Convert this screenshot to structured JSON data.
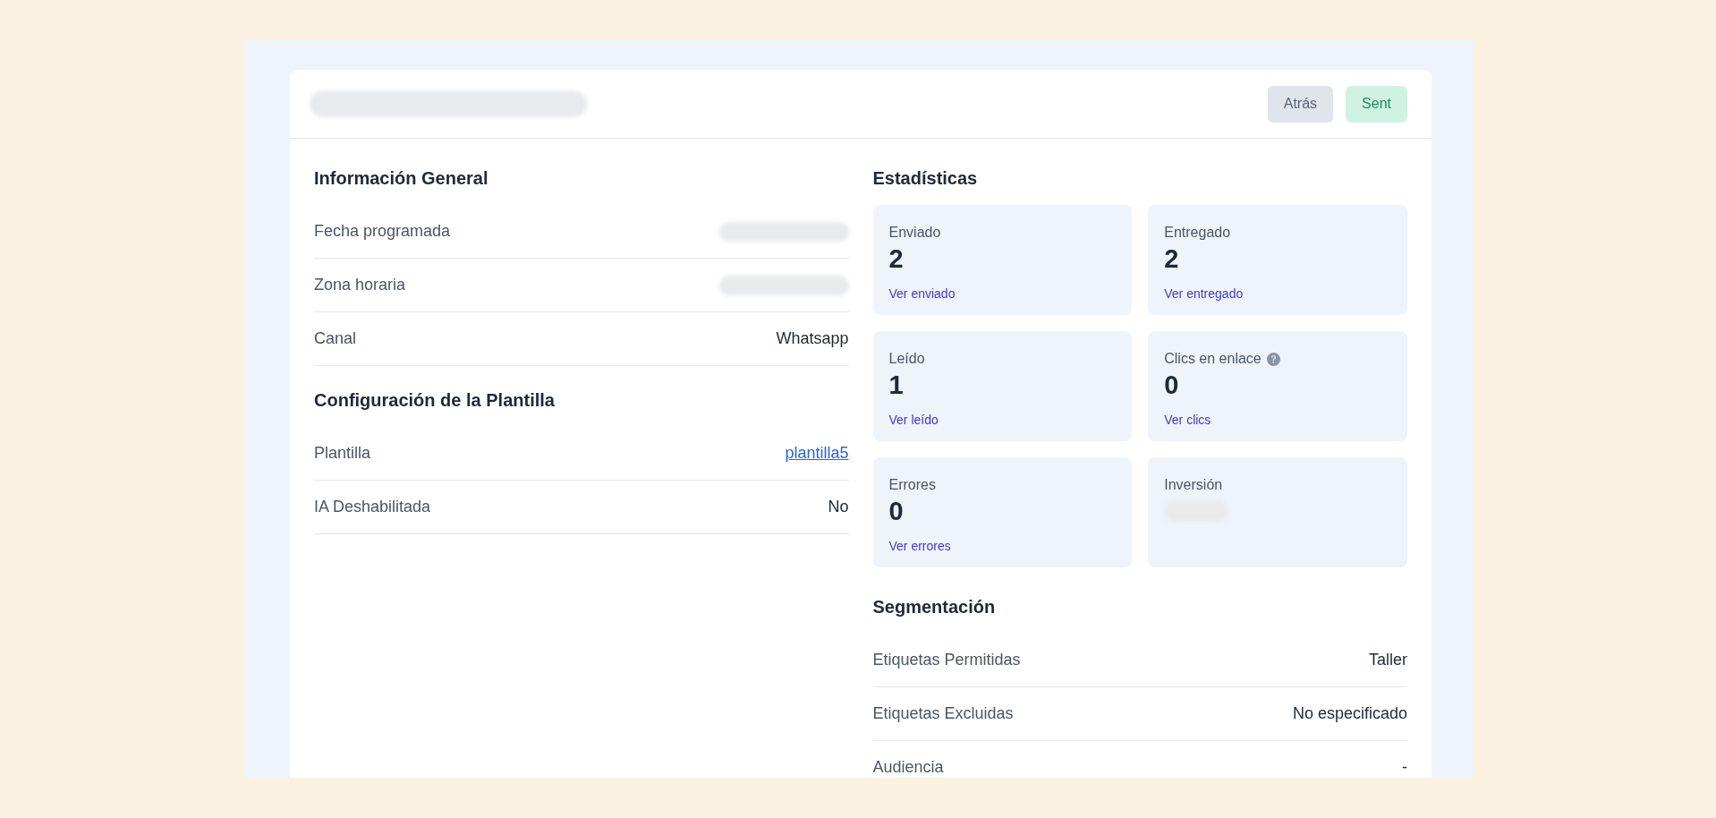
{
  "header": {
    "actions": [
      {
        "kind": "button",
        "label": "Atrás"
      },
      {
        "kind": "status",
        "label": "Sent"
      }
    ]
  },
  "general": {
    "title": "Información General",
    "rows": [
      {
        "label": "Fecha programada",
        "value_redacted": true
      },
      {
        "label": "Zona horaria",
        "value_redacted": true
      },
      {
        "label": "Canal",
        "value": "Whatsapp"
      }
    ]
  },
  "template": {
    "title": "Configuración de la Plantilla",
    "rows": [
      {
        "label": "Plantilla",
        "value": "plantilla5",
        "link": true
      },
      {
        "label": "IA Deshabilitada",
        "value": "No"
      }
    ]
  },
  "statistics": {
    "title": "Estadísticas",
    "cards": [
      {
        "label": "Enviado",
        "value": "2",
        "link": "Ver enviado"
      },
      {
        "label": "Entregado",
        "value": "2",
        "link": "Ver entregado"
      },
      {
        "label": "Leído",
        "value": "1",
        "link": "Ver leído"
      },
      {
        "label": "Clics en enlace",
        "help": true,
        "value": "0",
        "link": "Ver clics"
      },
      {
        "label": "Errores",
        "value": "0",
        "link": "Ver errores"
      },
      {
        "label": "Inversión",
        "value_redacted": true
      }
    ]
  },
  "segmentation": {
    "title": "Segmentación",
    "rows": [
      {
        "label": "Etiquetas Permitidas",
        "value": "Taller"
      },
      {
        "label": "Etiquetas Excluidas",
        "value": "No especificado"
      },
      {
        "label": "Audiencia",
        "value": "-"
      }
    ]
  }
}
